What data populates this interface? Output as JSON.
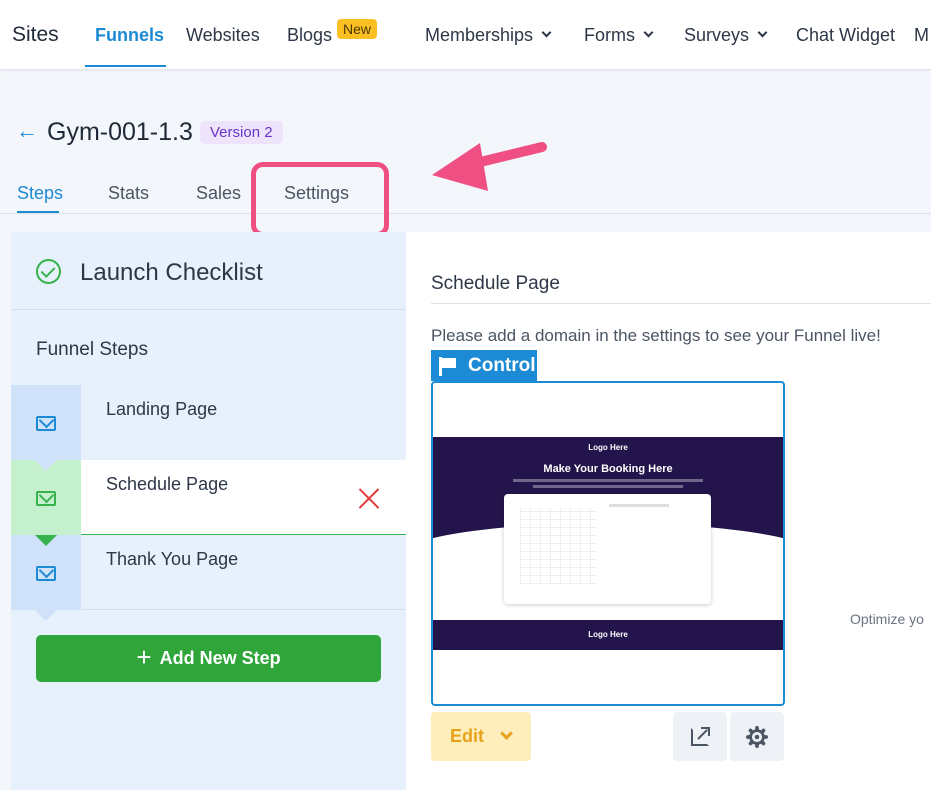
{
  "nav": {
    "sites": "Sites",
    "items": [
      "Funnels",
      "Websites",
      "Blogs",
      "Memberships",
      "Forms",
      "Surveys",
      "Chat Widget",
      "M"
    ],
    "new_badge": "New"
  },
  "header": {
    "back": "←",
    "title": "Gym-001-1.3",
    "version": "Version 2"
  },
  "tabs": [
    "Steps",
    "Stats",
    "Sales",
    "Settings"
  ],
  "left": {
    "checklist_title": "Launch Checklist",
    "funnel_steps_label": "Funnel Steps",
    "steps": [
      "Landing Page",
      "Schedule Page",
      "Thank You Page"
    ],
    "add_step": "Add New Step",
    "add_step_icon": "+"
  },
  "right": {
    "page_title": "Schedule Page",
    "domain_note": "Please add a domain in the settings to see your Funnel live!",
    "control_label": "Control",
    "preview": {
      "logo": "Logo Here",
      "headline": "Make Your Booking Here"
    },
    "edit_label": "Edit",
    "optimize_text": "Optimize yo"
  },
  "colors": {
    "accent": "#1c8ad4",
    "success": "#30a53a",
    "annotation": "#ef4f82",
    "warning_bg": "#fdeebc"
  }
}
